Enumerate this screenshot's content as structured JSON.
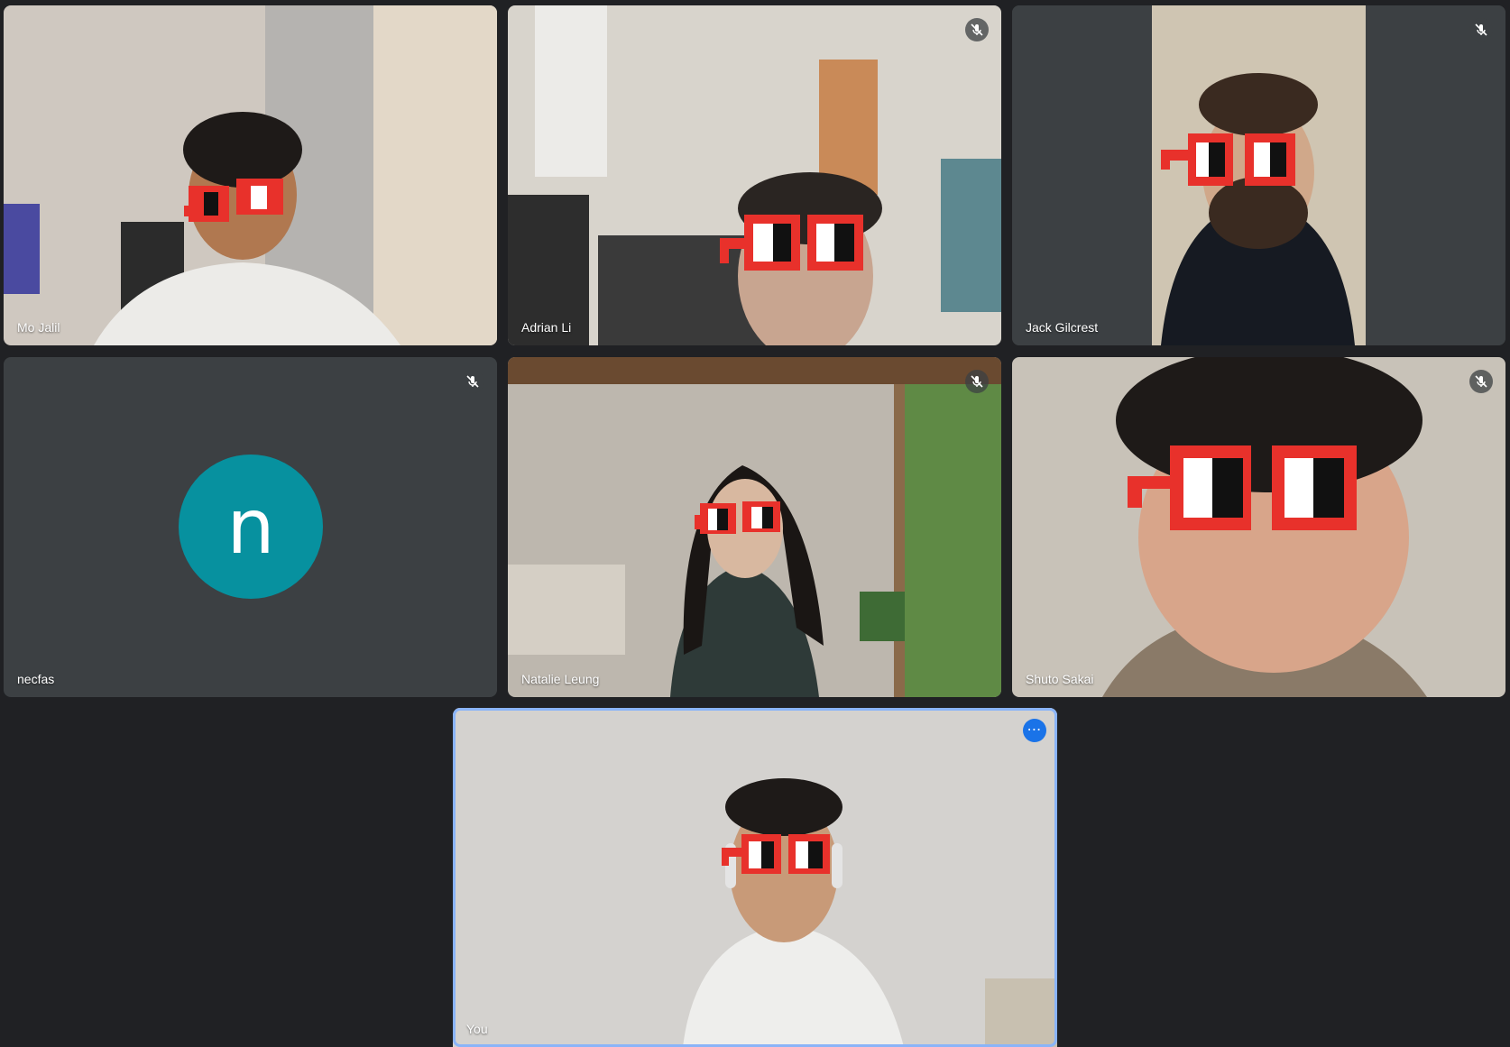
{
  "participants": [
    {
      "name": "Mo Jalil",
      "muted": false
    },
    {
      "name": "Adrian Li",
      "muted": true
    },
    {
      "name": "Jack Gilcrest",
      "muted": true
    },
    {
      "name": "necfas",
      "muted": true,
      "avatar_letter": "n"
    },
    {
      "name": "Natalie Leung",
      "muted": true
    },
    {
      "name": "Shuto Sakai",
      "muted": true
    }
  ],
  "self": {
    "name": "You",
    "more_options_icon": "more-horizontal-icon"
  },
  "colors": {
    "background": "#202124",
    "avatar": "#07919f",
    "self_border": "#8ab4f8",
    "accent": "#1a73e8",
    "glasses": "#e8312b"
  },
  "icons": {
    "muted": "mic-off-icon"
  }
}
